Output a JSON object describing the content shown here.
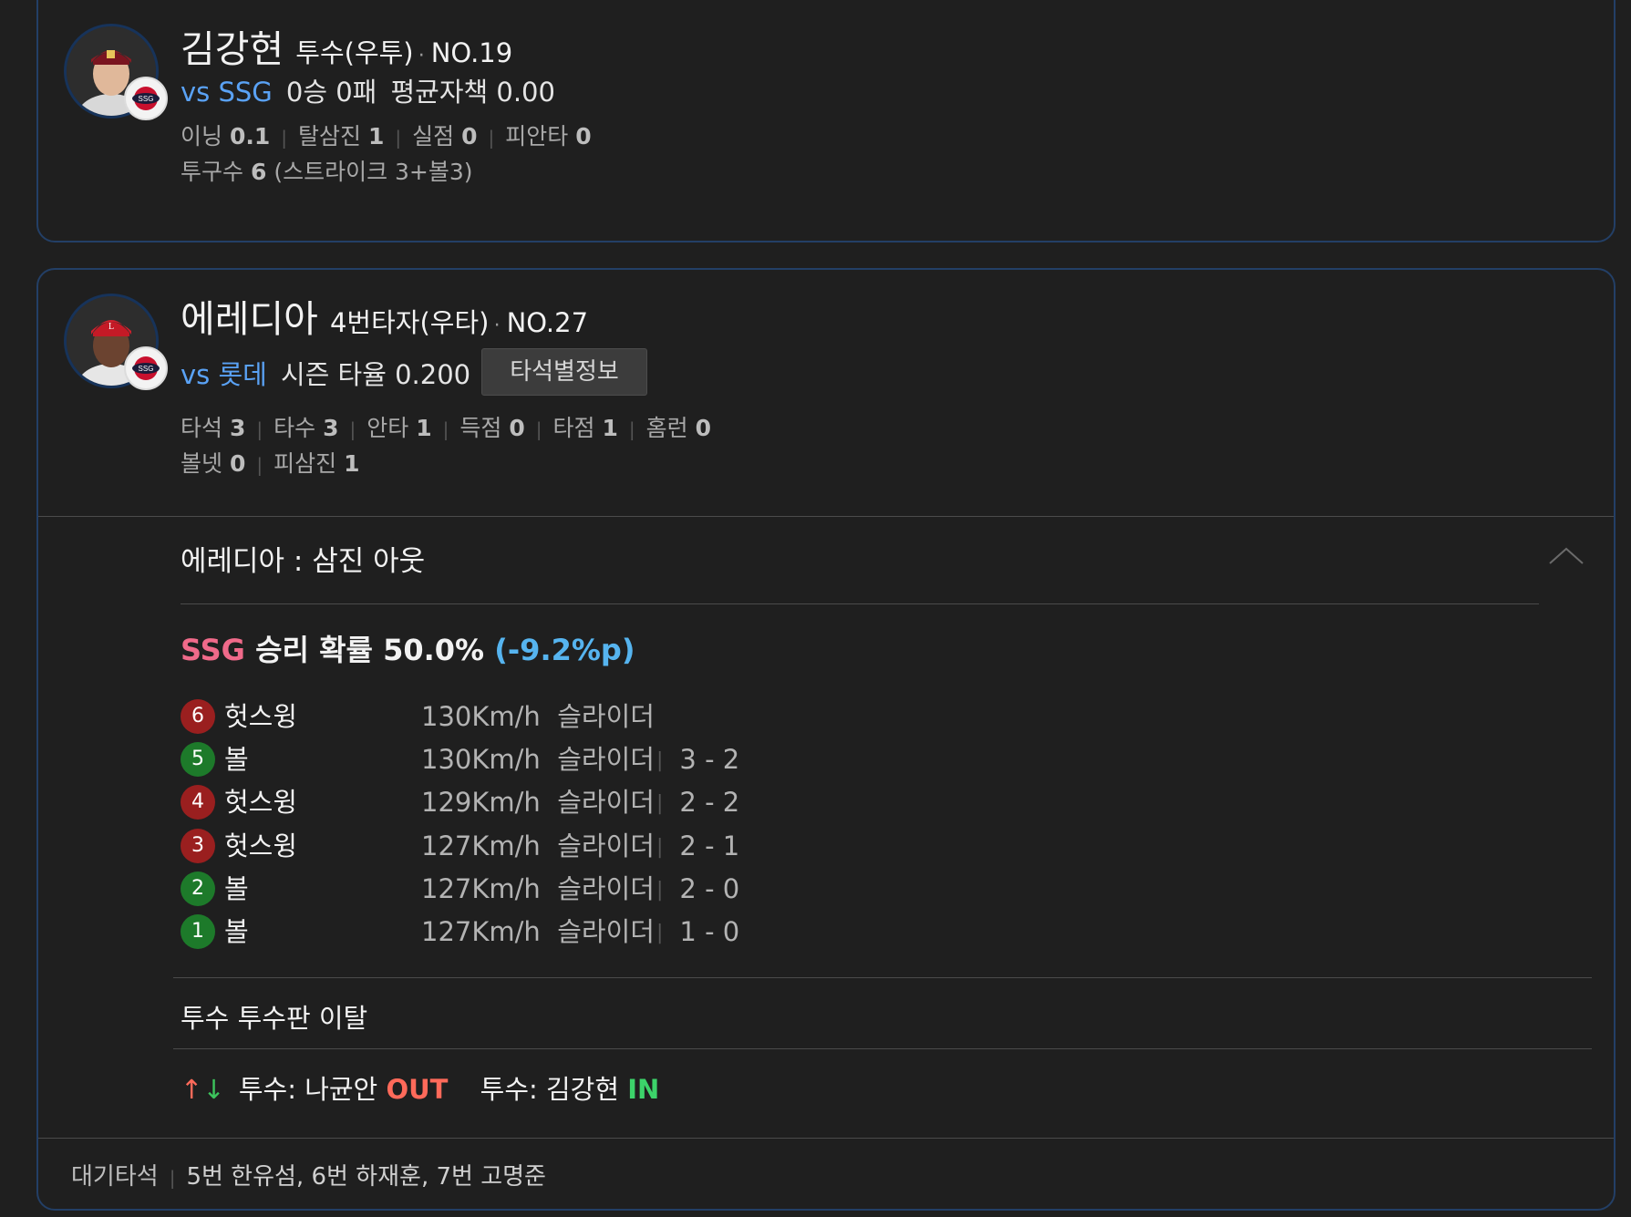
{
  "pitcher": {
    "name": "김강현",
    "role": "투수(우투)",
    "number": "NO.19",
    "vs": "vs SSG",
    "record": "0승 0패",
    "era": "평균자책 0.00",
    "stats": [
      {
        "label": "이닝",
        "value": "0.1"
      },
      {
        "label": "탈삼진",
        "value": "1"
      },
      {
        "label": "실점",
        "value": "0"
      },
      {
        "label": "피안타",
        "value": "0"
      }
    ],
    "pitch_count_label": "투구수",
    "pitch_count_value": "6",
    "pitch_count_detail": "(스트라이크 3+볼3)"
  },
  "batter": {
    "name": "에레디아",
    "role": "4번타자(우타)",
    "number": "NO.27",
    "vs": "vs 롯데",
    "season": "시즌 타율 0.200",
    "at_bat_button": "타석별정보",
    "stats_row1": [
      {
        "label": "타석",
        "value": "3"
      },
      {
        "label": "타수",
        "value": "3"
      },
      {
        "label": "안타",
        "value": "1"
      },
      {
        "label": "득점",
        "value": "0"
      },
      {
        "label": "타점",
        "value": "1"
      },
      {
        "label": "홈런",
        "value": "0"
      }
    ],
    "stats_row2": [
      {
        "label": "볼넷",
        "value": "0"
      },
      {
        "label": "피삼진",
        "value": "1"
      }
    ]
  },
  "play": {
    "result": "에레디아 : 삼진 아웃",
    "win_prob_team": "SSG",
    "win_prob_text": "승리 확률 50.0%",
    "win_prob_delta": "(-9.2%p)",
    "pitches": [
      {
        "num": "6",
        "type": "strike",
        "result": "헛스윙",
        "info": "130Km/h  슬라이더",
        "count": ""
      },
      {
        "num": "5",
        "type": "ball",
        "result": "볼",
        "info": "130Km/h  슬라이더",
        "count": "3 - 2"
      },
      {
        "num": "4",
        "type": "strike",
        "result": "헛스윙",
        "info": "129Km/h  슬라이더",
        "count": "2 - 2"
      },
      {
        "num": "3",
        "type": "strike",
        "result": "헛스윙",
        "info": "127Km/h  슬라이더",
        "count": "2 - 1"
      },
      {
        "num": "2",
        "type": "ball",
        "result": "볼",
        "info": "127Km/h  슬라이더",
        "count": "2 - 0"
      },
      {
        "num": "1",
        "type": "ball",
        "result": "볼",
        "info": "127Km/h  슬라이더",
        "count": "1 - 0"
      }
    ],
    "event": "투수 투수판 이탈",
    "sub_out_label": "투수: 나균안",
    "sub_out_tag": "OUT",
    "sub_in_label": "투수: 김강현",
    "sub_in_tag": "IN"
  },
  "on_deck": {
    "label": "대기타석",
    "players": "5번 한유섬, 6번 하재훈, 7번 고명준"
  },
  "colors": {
    "card_border": "#233f66",
    "vs_blue": "#5aa2f5",
    "ssg_pink": "#f06a8a",
    "delta_blue": "#56b4ef",
    "strike_red": "#9a1f1f",
    "ball_green": "#1d7a2a",
    "out_red": "#ff6a5a",
    "in_green": "#3cd36a"
  },
  "icons": {
    "pitcher_team_badge": "ssg-landers-logo-icon",
    "batter_team_badge": "ssg-landers-logo-icon",
    "collapse": "chevron-up-icon",
    "substitution": "swap-arrows-icon"
  }
}
